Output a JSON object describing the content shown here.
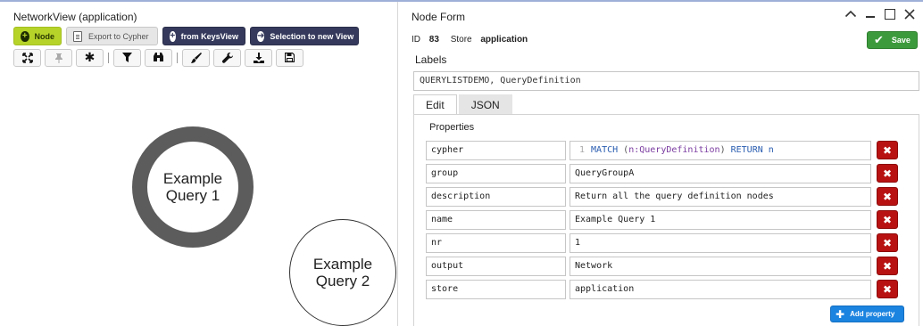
{
  "left": {
    "title": "NetworkView (application)",
    "toolbar1": {
      "node_label": "Node",
      "export_label": "Export to Cypher",
      "keys_label": "from KeysView",
      "selection_label": "Selection to new View"
    },
    "toolbar2": {
      "icons": [
        "expand-icon",
        "pin-icon",
        "asterisk-icon",
        "filter-icon",
        "binoculars-icon",
        "brush-icon",
        "wrench-icon",
        "download-icon",
        "save-icon"
      ]
    },
    "nodes": [
      {
        "line1": "Example",
        "line2": "Query 1",
        "selected": true
      },
      {
        "line1": "Example",
        "line2": "Query 2",
        "selected": false
      }
    ]
  },
  "form": {
    "title": "Node Form",
    "id_label": "ID",
    "id_value": "83",
    "store_label": "Store",
    "store_value": "application",
    "save_label": "Save",
    "labels_label": "Labels",
    "labels_value": "QUERYLISTDEMO, QueryDefinition",
    "tabs": [
      {
        "label": "Edit",
        "active": true
      },
      {
        "label": "JSON",
        "active": false
      }
    ],
    "properties_label": "Properties",
    "cypher": {
      "key": "cypher",
      "line_no": "1",
      "kw1": "MATCH",
      "lp": "(",
      "var": "n:QueryDefinition",
      "rp": ")",
      "kw2": "RETURN n"
    },
    "properties": [
      {
        "key": "group",
        "value": "QueryGroupA"
      },
      {
        "key": "description",
        "value": "Return all the query definition nodes"
      },
      {
        "key": "name",
        "value": "Example Query 1"
      },
      {
        "key": "nr",
        "value": "1"
      },
      {
        "key": "output",
        "value": "Network"
      },
      {
        "key": "store",
        "value": "application"
      }
    ],
    "delete_glyph": "✖",
    "add_property_label": "Add property"
  }
}
